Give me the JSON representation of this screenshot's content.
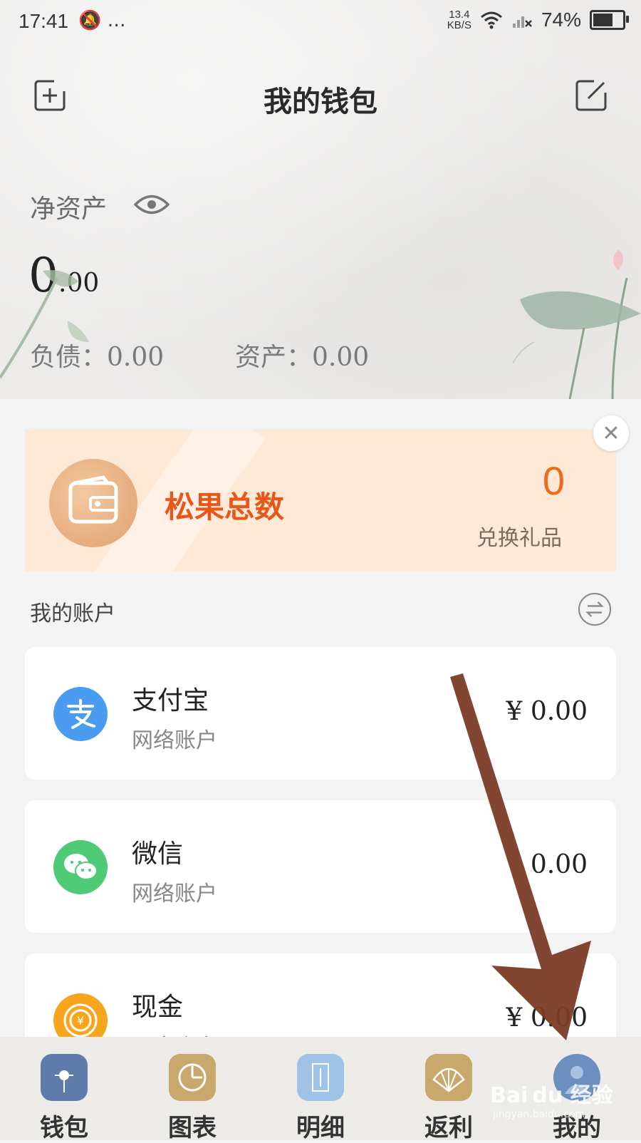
{
  "status_bar": {
    "time": "17:41",
    "extra": "…",
    "netspeed_value": "13.4",
    "netspeed_unit": "KB/S",
    "battery_percent": "74%",
    "battery_level": 0.74
  },
  "header": {
    "title": "我的钱包",
    "add_icon": "add-square-icon",
    "edit_icon": "edit-square-icon"
  },
  "summary": {
    "net_assets_label": "净资产",
    "net_assets_int": "0",
    "net_assets_dec": ".00",
    "debt_text": "负债：0.00",
    "assets_text": "资产：0.00"
  },
  "banner": {
    "label": "松果总数",
    "count": "0",
    "action": "兑换礼品",
    "close_icon": "close-icon"
  },
  "accounts": {
    "title": "我的账户",
    "items": [
      {
        "name": "支付宝",
        "type": "网络账户",
        "amount": "¥   0.00",
        "icon": "alipay-icon",
        "color": "#4a9cf0"
      },
      {
        "name": "微信",
        "type": "网络账户",
        "amount": "0.00",
        "icon": "wechat-icon",
        "color": "#4fcb77"
      },
      {
        "name": "现金",
        "type": "现金账户",
        "amount": "¥   0.00",
        "icon": "cash-icon",
        "color": "#f7a51c"
      }
    ]
  },
  "tabs": [
    {
      "label": "钱包",
      "icon": "wallet-tab-icon",
      "color": "#5f7bab"
    },
    {
      "label": "图表",
      "icon": "chart-tab-icon",
      "color": "#c9a86c"
    },
    {
      "label": "明细",
      "icon": "detail-tab-icon",
      "color": "#9ec3e6"
    },
    {
      "label": "返利",
      "icon": "rebate-tab-icon",
      "color": "#c9a86c"
    },
    {
      "label": "我的",
      "icon": "profile-tab-icon",
      "color": "#6d8fc0"
    }
  ],
  "watermark": {
    "text": "Bai du 经验",
    "sub": "jingyan.baidu.com"
  }
}
